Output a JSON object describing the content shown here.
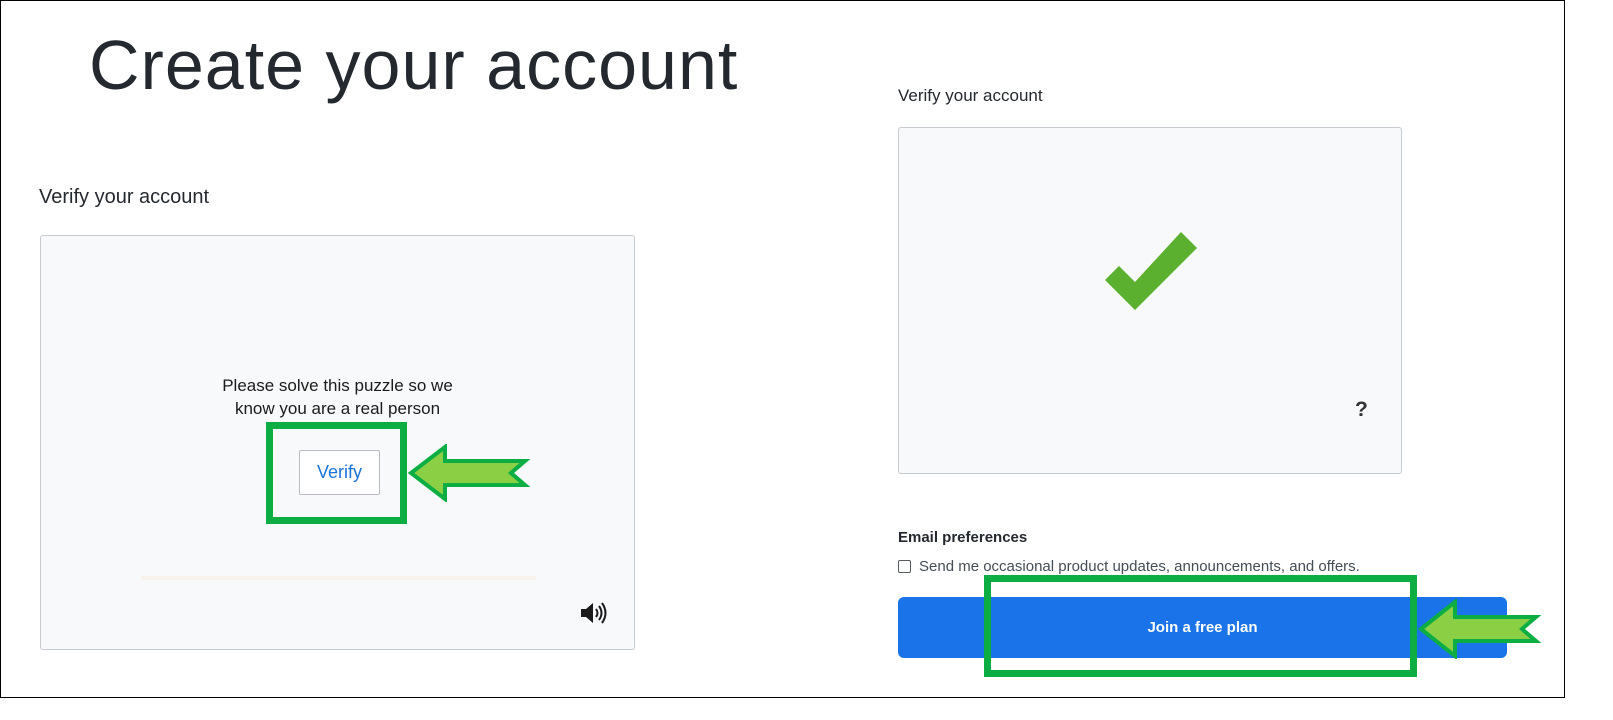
{
  "page": {
    "title": "Create your account"
  },
  "left_panel": {
    "section_label": "Verify your account",
    "puzzle": {
      "prompt_line1": "Please solve this puzzle so we",
      "prompt_line2": "know you are a real person",
      "verify_label": "Verify",
      "audio_icon": "speaker-icon"
    }
  },
  "right_panel": {
    "section_label": "Verify your account",
    "verified": {
      "status_icon": "checkmark-icon",
      "help_label": "?"
    },
    "email_preferences": {
      "label": "Email preferences",
      "opt_in_text": "Send me occasional product updates, announcements, and offers.",
      "opt_in_checked": false
    },
    "join_button_label": "Join a free plan"
  },
  "annotations": {
    "highlight_color": "#0cae44",
    "arrow_fill": "#8bcf45",
    "arrow_outline": "#0cae44"
  },
  "colors": {
    "primary_button": "#1a73e8",
    "checkmark": "#5bb030",
    "link_blue": "#1a73d9"
  }
}
